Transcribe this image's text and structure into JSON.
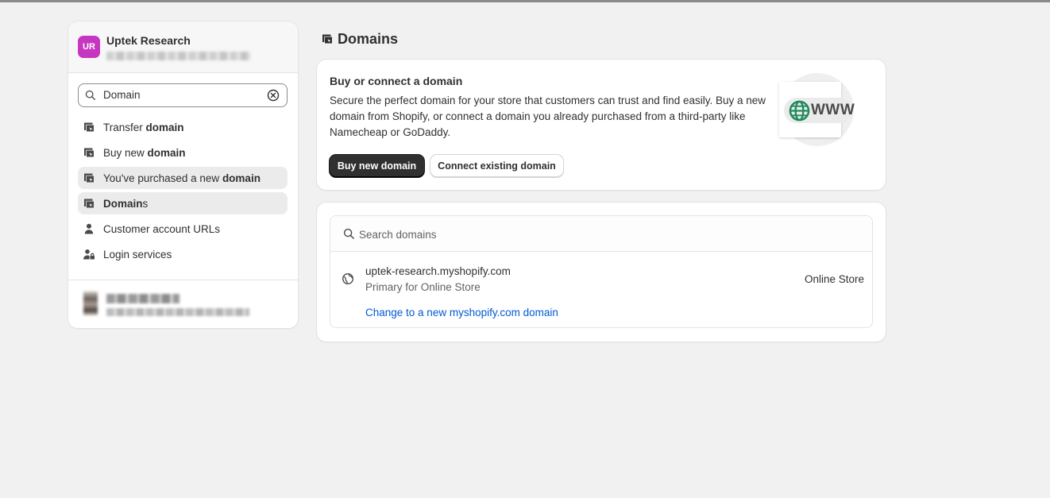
{
  "store": {
    "initials": "UR",
    "name": "Uptek Research",
    "avatar_color": "#c736c0"
  },
  "search": {
    "value": "Domain"
  },
  "results": [
    {
      "prefix": "Transfer ",
      "bold": "domain",
      "suffix": "",
      "icon": "domains-icon",
      "highlighted": false
    },
    {
      "prefix": "Buy new ",
      "bold": "domain",
      "suffix": "",
      "icon": "domains-icon",
      "highlighted": false
    },
    {
      "prefix": "You've purchased a new ",
      "bold": "domain",
      "suffix": "",
      "icon": "domains-icon",
      "highlighted": true
    },
    {
      "prefix": "",
      "bold": "Domain",
      "suffix": "s",
      "icon": "domains-icon",
      "highlighted": true
    },
    {
      "prefix": "Customer account URLs",
      "bold": "",
      "suffix": "",
      "icon": "person-icon",
      "highlighted": false
    },
    {
      "prefix": "Login services",
      "bold": "",
      "suffix": "",
      "icon": "person-lock-icon",
      "highlighted": false
    }
  ],
  "page": {
    "title": "Domains"
  },
  "buy_card": {
    "heading": "Buy or connect a domain",
    "description": "Secure the perfect domain for your store that customers can trust and find easily. Buy a new domain from Shopify, or connect a domain you already purchased from a third-party like Namecheap or GoDaddy.",
    "primary_label": "Buy new domain",
    "secondary_label": "Connect existing domain",
    "illustration_text": "WWW"
  },
  "domains_card": {
    "search_placeholder": "Search domains",
    "rows": [
      {
        "name": "uptek-research.myshopify.com",
        "subtitle": "Primary for Online Store",
        "channel": "Online Store",
        "link": "Change to a new myshopify.com domain"
      }
    ]
  },
  "colors": {
    "background": "#f1f1f1",
    "primary_button": "#303030",
    "link": "#005bd3",
    "globe": "#1f8a5c"
  }
}
